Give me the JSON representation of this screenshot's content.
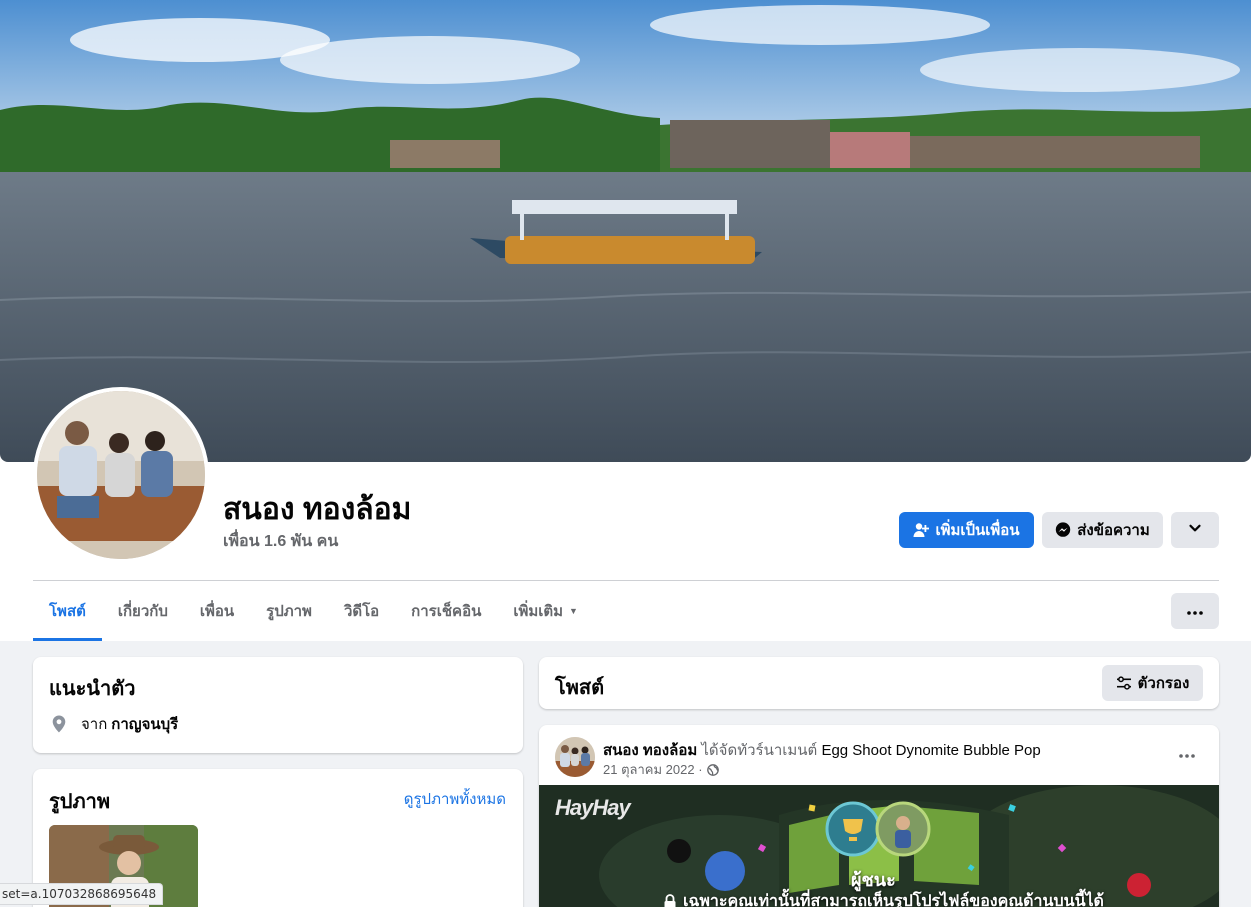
{
  "profile": {
    "name": "สนอง ทองล้อม",
    "friends_count": "เพื่อน 1.6 พัน คน"
  },
  "actions": {
    "add_friend": "เพิ่มเป็นเพื่อน",
    "message": "ส่งข้อความ"
  },
  "tabs": [
    {
      "label": "โพสต์",
      "active": true
    },
    {
      "label": "เกี่ยวกับ",
      "active": false
    },
    {
      "label": "เพื่อน",
      "active": false
    },
    {
      "label": "รูปภาพ",
      "active": false
    },
    {
      "label": "วิดีโอ",
      "active": false
    },
    {
      "label": "การเช็คอิน",
      "active": false
    },
    {
      "label": "เพิ่มเติม",
      "active": false
    }
  ],
  "intro": {
    "title": "แนะนำตัว",
    "from_label": "จาก",
    "hometown": "กาญจนบุรี"
  },
  "photos": {
    "title": "รูปภาพ",
    "see_all": "ดูรูปภาพทั้งหมด"
  },
  "posts_header": {
    "title": "โพสต์",
    "filter": "ตัวกรอง"
  },
  "post": {
    "author": "สนอง ทองล้อม",
    "action": "ได้จัดทัวร์นาเมนต์",
    "game": "Egg Shoot Dynomite Bubble Pop",
    "date": "21 ตุลาคม 2022 ·",
    "media": {
      "brand": "HayHay",
      "winner_label": "ผู้ชนะ",
      "privacy_note": "เฉพาะคุณเท่านั้นที่สามารถเห็นรูปโปรไฟล์ของคุณด้านบนนี้ได้"
    }
  },
  "status_bar": {
    "url": "set=a.107032868695648"
  },
  "colors": {
    "accent": "#1b74e4",
    "page_bg": "#f0f2f5",
    "secondary_button": "#e4e6eb",
    "muted_text": "#65676b"
  }
}
